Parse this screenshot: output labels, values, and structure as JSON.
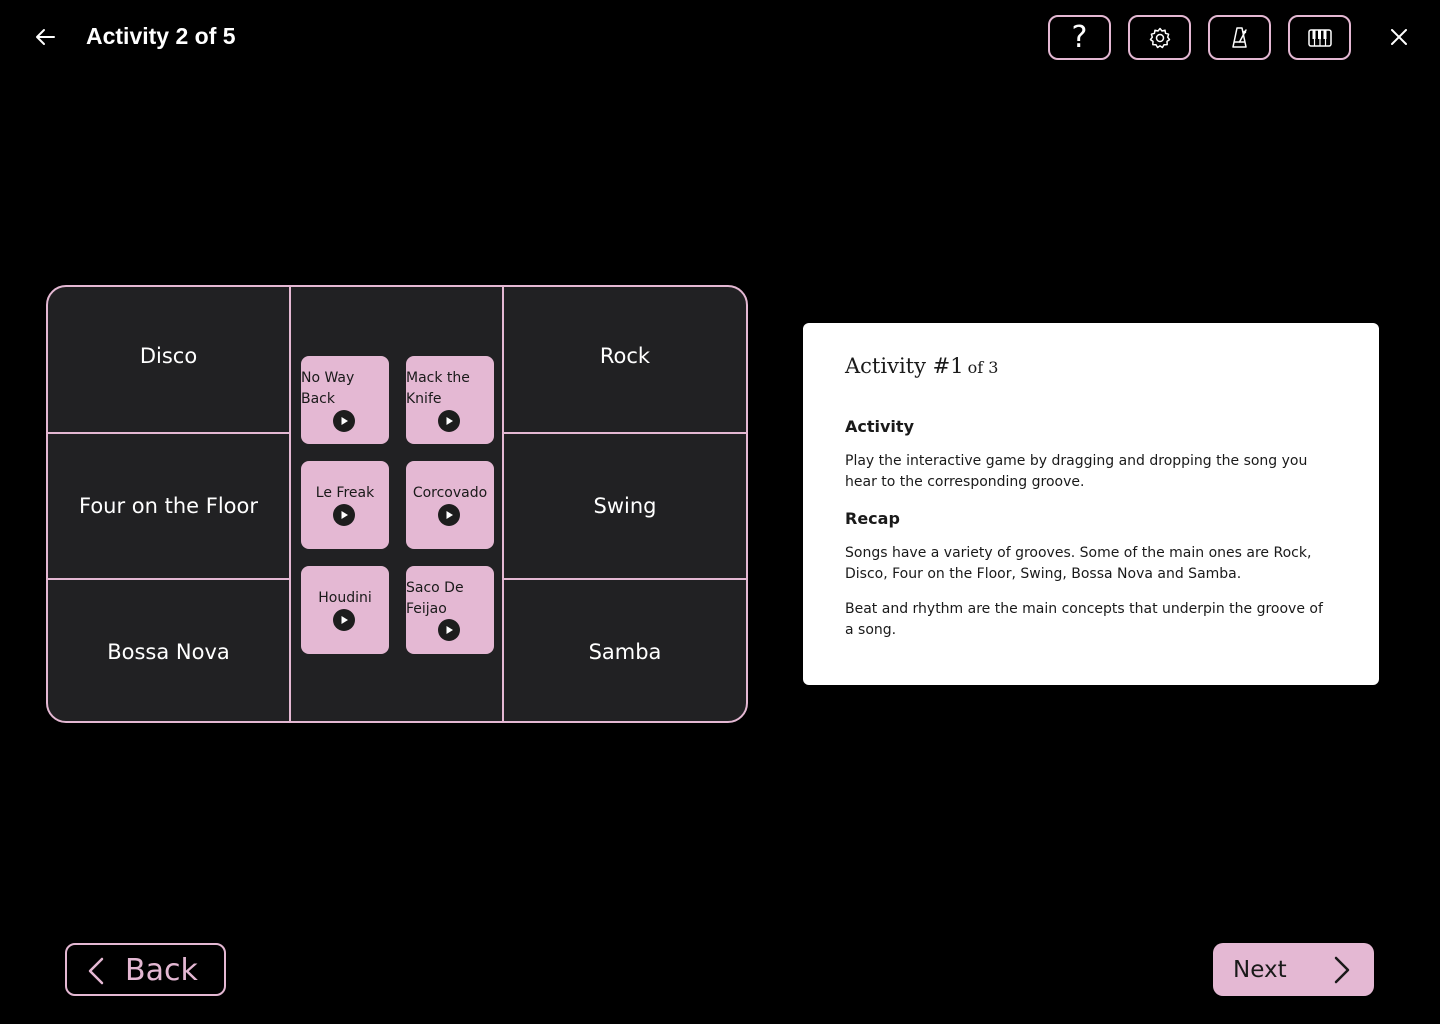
{
  "header": {
    "title": "Activity 2 of 5",
    "tools": [
      {
        "name": "help",
        "glyph": "?"
      },
      {
        "name": "settings"
      },
      {
        "name": "metronome"
      },
      {
        "name": "piano"
      }
    ]
  },
  "grooves": {
    "left": [
      "Disco",
      "Four on the Floor",
      "Bossa Nova"
    ],
    "right": [
      "Rock",
      "Swing",
      "Samba"
    ]
  },
  "songs": [
    {
      "title": "No Way Back",
      "line1": "No Way",
      "line2": "Back"
    },
    {
      "title": "Mack the Knife",
      "line1": "Mack the",
      "line2": "Knife"
    },
    {
      "title": "Le Freak",
      "line1": "Le Freak",
      "line2": ""
    },
    {
      "title": "Corcovado",
      "line1": "Corcovado",
      "line2": ""
    },
    {
      "title": "Houdini",
      "line1": "Houdini",
      "line2": ""
    },
    {
      "title": "Saco De Feijao",
      "line1": "Saco De",
      "line2": "Feijao"
    }
  ],
  "card": {
    "title": "Activity #1",
    "title_suffix": "of 3",
    "activity_heading": "Activity",
    "activity_text": "Play the interactive game by dragging and dropping the song you hear to the corresponding groove.",
    "recap_heading": "Recap",
    "recap_text_1": "Songs have a variety of grooves. Some of the main ones are Rock, Disco, Four on the Floor, Swing, Bossa Nova and Samba.",
    "recap_text_2": "Beat and rhythm are the main concepts that underpin the groove of a song."
  },
  "nav": {
    "back_label": "Back",
    "next_label": "Next"
  },
  "colors": {
    "accent": "#e4b8d3",
    "background": "#000000",
    "board": "#212123"
  }
}
